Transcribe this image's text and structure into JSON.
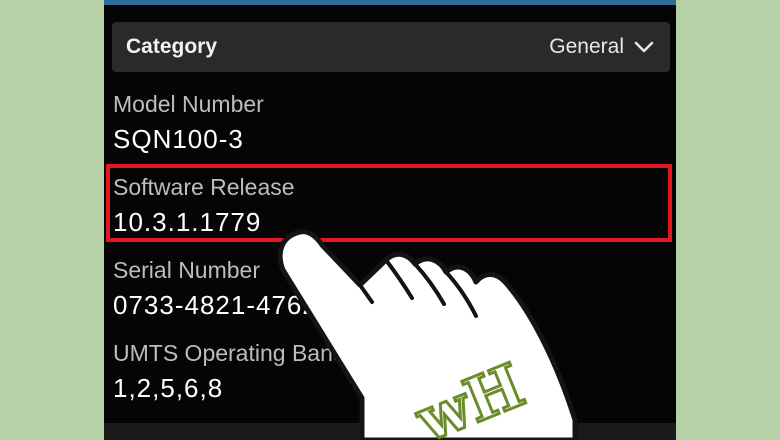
{
  "category": {
    "label": "Category",
    "value": "General"
  },
  "rows": [
    {
      "label": "Model Number",
      "value": "SQN100-3"
    },
    {
      "label": "Software Release",
      "value": "10.3.1.1779"
    },
    {
      "label": "Serial Number",
      "value": "0733-4821-4762"
    },
    {
      "label": "UMTS Operating Bands Capability",
      "value": "1,2,5,6,8"
    }
  ],
  "watermark": "wH",
  "colors": {
    "background": "#b7d1a6",
    "screen": "#050505",
    "highlight": "#e3181f",
    "accent": "#2d6e9b"
  },
  "icons": {
    "category_dropdown": "chevron-down-icon",
    "pointer": "hand-pointer-icon"
  }
}
